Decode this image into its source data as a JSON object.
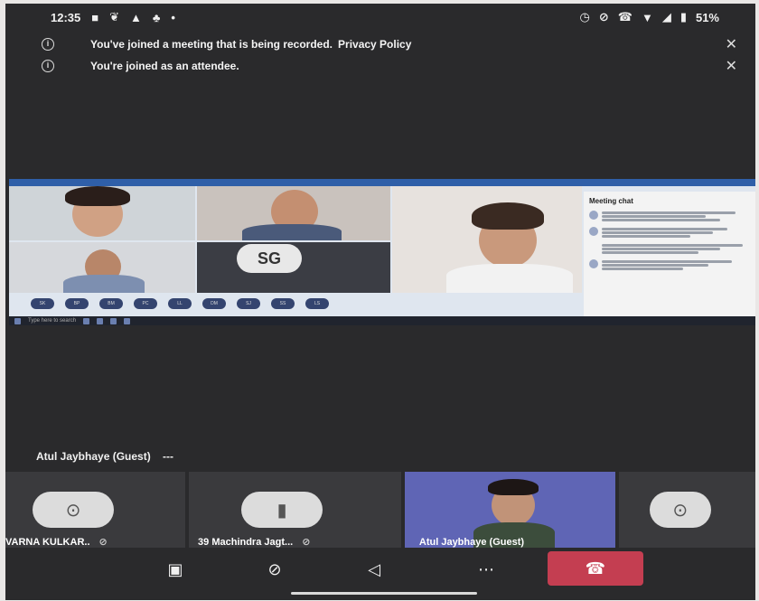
{
  "status_bar": {
    "time": "12:35",
    "battery": "51%",
    "left_icons": [
      "teams-icon",
      "twitter-icon",
      "warning-icon",
      "app-icon",
      "dot-icon"
    ],
    "right_icons": [
      "alarm-icon",
      "mute-icon",
      "call-icon",
      "wifi-icon",
      "4g-signal-icon",
      "battery-icon"
    ]
  },
  "notices": [
    {
      "text": "You've joined a meeting that is being recorded.",
      "link": "Privacy Policy"
    },
    {
      "text": "You're joined as an attendee.",
      "link": ""
    }
  ],
  "shared_screen": {
    "presenter_initials": "SG",
    "chat_title": "Meeting chat",
    "participant_pills": [
      "SK",
      "BP",
      "BM",
      "PC",
      "LL",
      "DM",
      "SJ",
      "SS",
      "LS"
    ],
    "taskbar_search": "Type here to search"
  },
  "participants": [
    {
      "name": "VARNA KULKAR..",
      "mic_muted": true,
      "type": "avatar"
    },
    {
      "name": "39 Machindra Jagt...",
      "mic_muted": true,
      "type": "avatar"
    },
    {
      "name": "Atul Jaybhaye (Guest)",
      "mic_muted": false,
      "type": "video"
    },
    {
      "name": "",
      "mic_muted": false,
      "type": "avatar"
    }
  ],
  "active_speaker": {
    "name": "Atul Jaybhaye (Guest)",
    "more": "---"
  },
  "controls": {
    "camera": "camera-off-icon",
    "mic": "mic-off-icon",
    "speaker": "speaker-off-icon",
    "more": "more-icon",
    "hangup": "hang-up-icon"
  },
  "colors": {
    "background": "#2a2a2c",
    "hangup": "#c43e51",
    "video_tile": "#5f65b5",
    "share_banner": "#3a6ec2"
  }
}
